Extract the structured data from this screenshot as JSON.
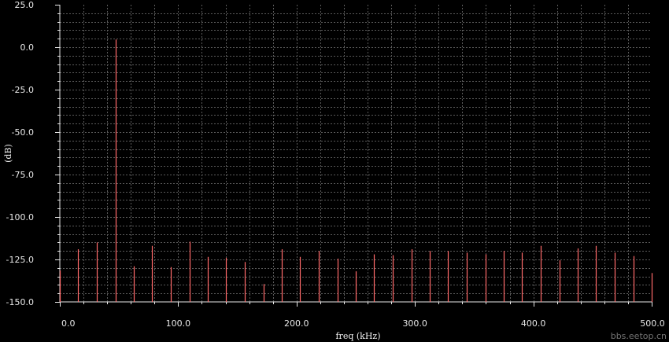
{
  "colors": {
    "background": "#000000",
    "bar": "#ff6a6a",
    "grid": "#5a5a5a",
    "text": "#e8e8e8"
  },
  "watermark": "bbs.eetop.cn",
  "chart_data": {
    "type": "bar",
    "xlabel": "freq (kHz)",
    "ylabel": "(dB)",
    "xlim": [
      0,
      500
    ],
    "ylim": [
      -150,
      25
    ],
    "x_ticks": [
      "0.0",
      "100.0",
      "200.0",
      "300.0",
      "400.0",
      "500.0"
    ],
    "y_ticks": [
      "25.0",
      "0.0",
      "-25.0",
      "-50.0",
      "-75.0",
      "-100.0",
      "-125.0",
      "-150.0"
    ],
    "grid": true,
    "baseline": -150,
    "x": [
      0,
      15.6,
      31.3,
      46.9,
      62.5,
      78.1,
      93.8,
      109.4,
      125,
      140.6,
      156.3,
      171.9,
      187.5,
      203.1,
      218.8,
      234.4,
      250,
      265.6,
      281.3,
      296.9,
      312.5,
      328.1,
      343.8,
      359.4,
      375,
      390.6,
      406.3,
      421.9,
      437.5,
      453.1,
      468.8,
      484.4,
      500
    ],
    "values": [
      -131.5,
      -119,
      -115,
      4.5,
      -129,
      -117,
      -129.5,
      -114.5,
      -123.5,
      -124,
      -126.5,
      -139.5,
      -119,
      -123.5,
      -120,
      -124.5,
      -132,
      -122,
      -122.5,
      -119,
      -120,
      -120,
      -121,
      -122,
      -120,
      -121,
      -117,
      -125.5,
      -118.5,
      -117,
      -121,
      -123,
      -133
    ]
  }
}
